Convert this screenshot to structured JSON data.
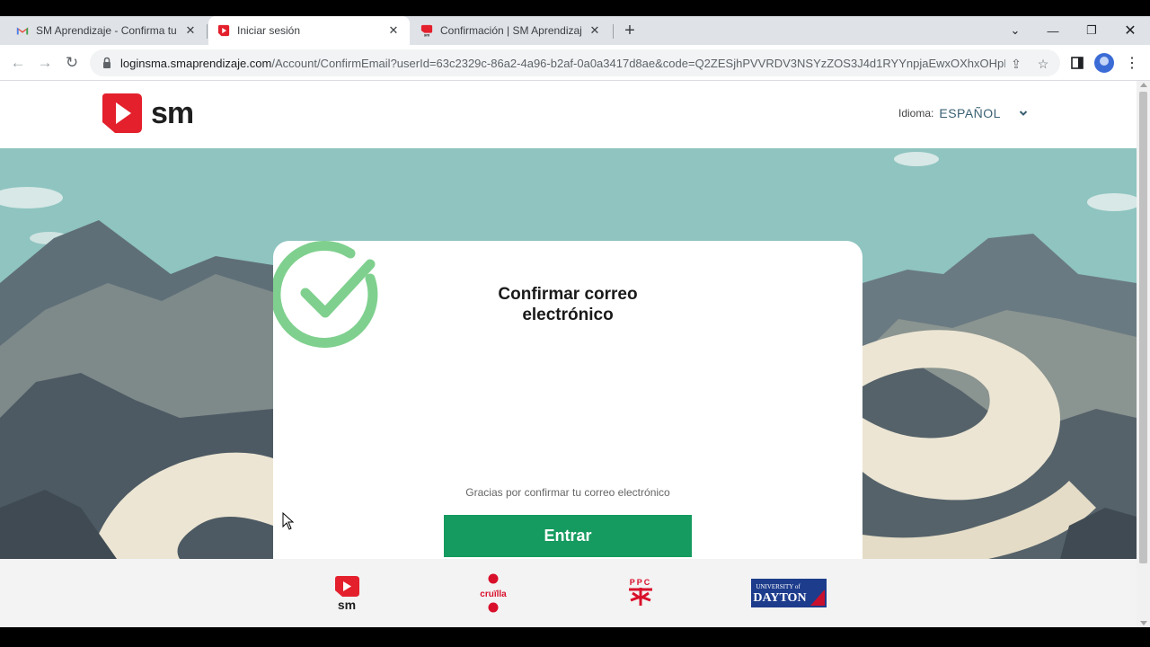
{
  "browser": {
    "tabs": [
      {
        "title": "SM Aprendizaje - Confirma tu e-mail",
        "icon": "gmail-icon",
        "active": false
      },
      {
        "title": "Iniciar sesión",
        "icon": "sm-favicon",
        "active": true
      },
      {
        "title": "Confirmación | SM Aprendizaje",
        "icon": "sm-favicon",
        "active": false
      }
    ],
    "new_tab": "+",
    "url_host": "loginsma.smaprendizaje.com",
    "url_path": "/Account/ConfirmEmail?userId=63c2329c-86a2-4a96-b2af-0a0a3417d8ae&code=Q2ZESjhPVVRDV3NSYzZOS3J4d1RYYnpjaEwxOXhxOHpE..."
  },
  "header": {
    "logo_text": "sm",
    "language_label": "Idioma:",
    "language_value": "ESPAÑOL"
  },
  "card": {
    "title": "Confirmar correo electrónico",
    "message": "Gracias por confirmar tu correo electrónico",
    "button_label": "Entrar"
  },
  "footer": {
    "brands": [
      {
        "name": "sm",
        "icon": "sm-brand-logo"
      },
      {
        "name": "cruïlla",
        "icon": "cruilla-brand-logo"
      },
      {
        "name": "PPC",
        "icon": "ppc-brand-logo"
      },
      {
        "name": "UNIVERSITY of DAYTON",
        "icon": "dayton-brand-logo"
      }
    ]
  },
  "colors": {
    "brand_red": "#e3202c",
    "button_green": "#159a5f",
    "check_green": "#7fd08e",
    "sky": "#8fc4c0"
  }
}
